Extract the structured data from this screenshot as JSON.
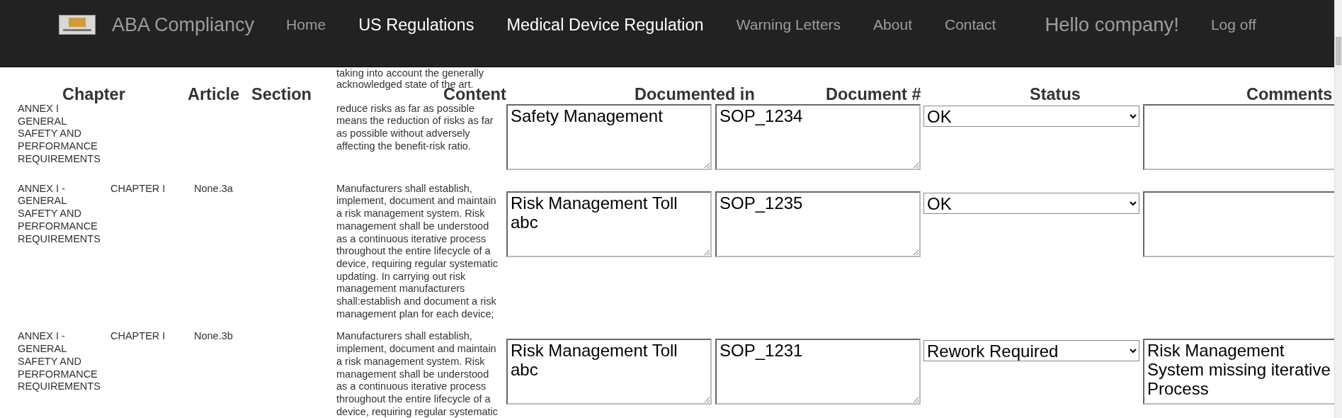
{
  "navbar": {
    "brand": "ABA Compliancy",
    "links": [
      {
        "label": "Home",
        "active": false
      },
      {
        "label": "US Regulations",
        "active": true
      },
      {
        "label": "Medical Device Regulation",
        "active": true
      },
      {
        "label": "Warning Letters",
        "active": false
      },
      {
        "label": "About",
        "active": false
      },
      {
        "label": "Contact",
        "active": false
      }
    ],
    "greeting": "Hello company!",
    "logoff": "Log off"
  },
  "table": {
    "columns": [
      "Chapter",
      "Article",
      "Section",
      "Content",
      "Documented in",
      "Document #",
      "Status",
      "Comments"
    ],
    "rows": [
      {
        "annex": "ANNEX I GENERAL SAFETY AND PERFORMANCE REQUIREMENTS",
        "content": [
          "taking into account the generally acknowledged state of the art.",
          "reduce risks as far as possible means the reduction of risks as far as possible without adversely affecting the benefit-risk ratio."
        ],
        "documented_in": "Safety Management",
        "document_no": "SOP_1234",
        "status": "OK"
      },
      {
        "annex": "ANNEX I - GENERAL SAFETY AND PERFORMANCE REQUIREMENTS",
        "chapter": "CHAPTER I",
        "article": "None.3a",
        "content": [
          "Manufacturers shall establish, implement, document and maintain a risk management system. Risk management shall be understood as a continuous iterative process throughout the entire lifecycle of a device, requiring regular systematic updating. In carrying out risk management manufacturers shall:establish and document a risk management plan for each device;"
        ],
        "documented_in": "Risk Management Toll abc",
        "document_no": "SOP_1235",
        "status": "OK"
      },
      {
        "annex": "ANNEX I - GENERAL SAFETY AND PERFORMANCE REQUIREMENTS",
        "chapter": "CHAPTER I",
        "article": "None.3b",
        "content": [
          "Manufacturers shall establish, implement, document and maintain a risk management system. Risk management shall be understood as a continuous iterative process throughout the entire lifecycle of a device, requiring regular systematic"
        ],
        "documented_in": "Risk Management Toll abc",
        "document_no": "SOP_1231",
        "status": "Rework Required",
        "comments": "Risk Management System missing iterative Process"
      }
    ]
  }
}
